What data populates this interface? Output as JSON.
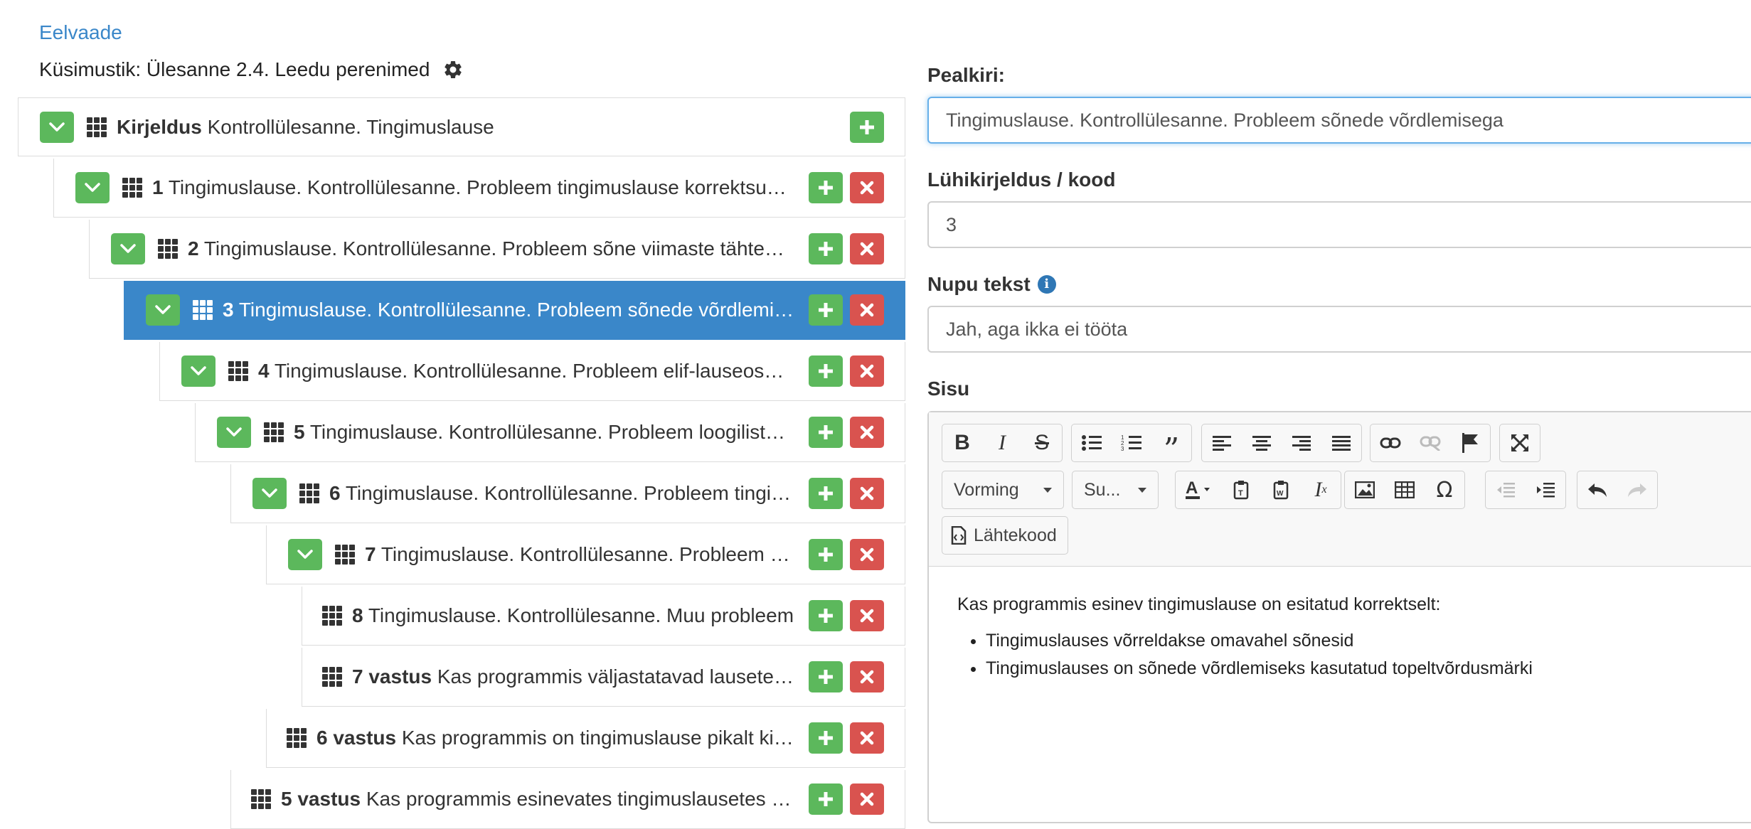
{
  "header": {
    "preview_link": "Eelvaade",
    "quiz_title": "Küsimustik: Ülesanne 2.4. Leedu perenimed"
  },
  "tree": [
    {
      "bold": "Kirjeldus",
      "text": " Kontrollülesanne. Tingimuslause",
      "expand": true,
      "delete": false,
      "active": false
    },
    {
      "bold": "1",
      "text": " Tingimuslause. Kontrollülesanne. Probleem tingimuslause korrektsusega",
      "expand": true,
      "delete": true,
      "active": false
    },
    {
      "bold": "2",
      "text": " Tingimuslause. Kontrollülesanne. Probleem sõne viimaste tähtede kontrolliga",
      "expand": true,
      "delete": true,
      "active": false
    },
    {
      "bold": "3",
      "text": " Tingimuslause. Kontrollülesanne. Probleem sõnede võrdlemisega",
      "expand": true,
      "delete": true,
      "active": true
    },
    {
      "bold": "4",
      "text": " Tingimuslause. Kontrollülesanne. Probleem elif-lauseosaga",
      "expand": true,
      "delete": true,
      "active": false
    },
    {
      "bold": "5",
      "text": " Tingimuslause. Kontrollülesanne. Probleem loogiliste tehetega",
      "expand": true,
      "delete": true,
      "active": false
    },
    {
      "bold": "6",
      "text": " Tingimuslause. Kontrollülesanne. Probleem tingimusega",
      "expand": true,
      "delete": true,
      "active": false
    },
    {
      "bold": "7",
      "text": " Tingimuslause. Kontrollülesanne. Probleem väljundiga",
      "expand": true,
      "delete": true,
      "active": false
    },
    {
      "bold": "8",
      "text": " Tingimuslause. Kontrollülesanne. Muu probleem",
      "expand": false,
      "delete": true,
      "active": false
    },
    {
      "bold": "7 vastus",
      "text": " Kas programmis väljastatavad lausete osad on korrektsed",
      "expand": false,
      "delete": true,
      "active": false
    },
    {
      "bold": "6 vastus",
      "text": " Kas programmis on tingimuslause pikalt kirjutatud",
      "expand": false,
      "delete": true,
      "active": false
    },
    {
      "bold": "5 vastus",
      "text": " Kas programmis esinevates tingimuslausetes on loogilised tehted",
      "expand": false,
      "delete": true,
      "active": false
    }
  ],
  "form": {
    "title_label": "Pealkiri:",
    "title_value": "Tingimuslause. Kontrollülesanne. Probleem sõnede võrdlemisega",
    "code_label": "Lühikirjeldus / kood",
    "code_value": "3",
    "button_label": "Nupu tekst",
    "button_value": "Jah, aga ikka ei tööta",
    "content_label": "Sisu"
  },
  "editor": {
    "format_combo": "Vorming",
    "size_combo": "Su...",
    "source_button": "Lähtekood",
    "paragraph": "Kas programmis esinev tingimuslause on esitatud korrektselt:",
    "bullets": [
      "Tingimuslauses võrreldakse omavahel sõnesid",
      "Tingimuslauses on sõnede võrdlemiseks kasutatud topeltvõrdusmärki"
    ]
  },
  "colors": {
    "link": "#3a87c9",
    "active_row": "#3a87c9",
    "add_button": "#5cb85c",
    "delete_button": "#d9534f"
  }
}
